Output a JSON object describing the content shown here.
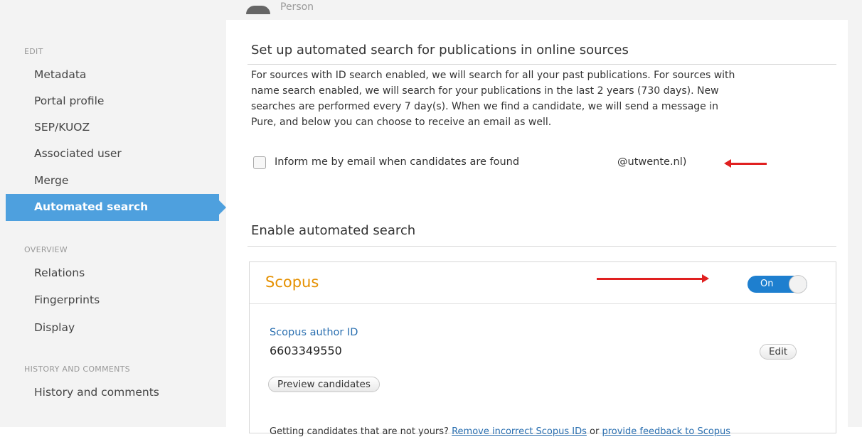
{
  "header": {
    "person_label": "Person"
  },
  "sidebar": {
    "edit_section": "EDIT",
    "edit_items": [
      "Metadata",
      "Portal profile",
      "SEP/KUOZ",
      "Associated user",
      "Merge"
    ],
    "active_item": "Automated search",
    "overview_section": "OVERVIEW",
    "overview_items": [
      "Relations",
      "Fingerprints",
      "Display"
    ],
    "history_section": "HISTORY AND COMMENTS",
    "history_items": [
      "History and comments"
    ]
  },
  "main": {
    "setup_title": "Set up automated search for publications in online sources",
    "setup_text_lines": [
      "For sources with ID search enabled, we will search for all your past publications. For sources with",
      "name search enabled, we will search for your publications in the last 2 years (730 days). New",
      "searches are performed every 7 day(s). When we find a candidate, we will send a message in",
      "Pure, and below you can choose to receive an email as well."
    ],
    "email_checkbox_label": "Inform me by email when candidates are found",
    "email_checkbox_checked": false,
    "email_suffix": "@utwente.nl)",
    "enable_title": "Enable automated search",
    "scopus": {
      "title": "Scopus",
      "toggle_label": "On",
      "author_id_label": "Scopus author ID",
      "author_id": "6603349550",
      "edit_button": "Edit",
      "preview_button": "Preview candidates",
      "note_prefix": "Getting candidates that are not yours?",
      "remove_link": "Remove incorrect Scopus IDs",
      "note_or": "or",
      "feedback_link": "provide feedback to Scopus"
    }
  },
  "colors": {
    "accent": "#4ea0de",
    "scopus_orange": "#e59000",
    "toggle_blue": "#1e7fcf",
    "annotation_arrow": "#e02020",
    "link": "#2a6fb0"
  }
}
